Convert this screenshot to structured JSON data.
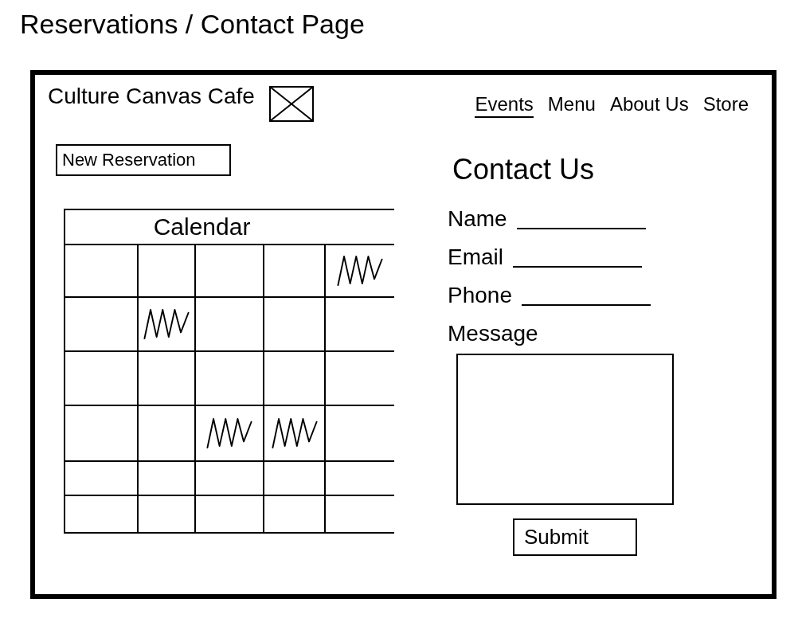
{
  "page_title": "Reservations / Contact Page",
  "header": {
    "brand": "Culture Canvas Cafe",
    "nav": [
      {
        "label": "Events",
        "selected": true
      },
      {
        "label": "Menu",
        "selected": false
      },
      {
        "label": "About Us",
        "selected": false
      },
      {
        "label": "Store",
        "selected": false
      }
    ]
  },
  "reservations": {
    "new_button": "New Reservation",
    "calendar": {
      "title": "Calendar",
      "weeks": [
        {
          "days": [
            {
              "marked": false
            },
            {
              "marked": false
            },
            {
              "marked": false
            },
            {
              "marked": false
            },
            {
              "marked": true
            }
          ]
        },
        {
          "days": [
            {
              "marked": false
            },
            {
              "marked": true
            },
            {
              "marked": false
            },
            {
              "marked": false
            },
            {
              "marked": false
            }
          ]
        },
        {
          "days": [
            {
              "marked": false
            },
            {
              "marked": false
            },
            {
              "marked": false
            },
            {
              "marked": false
            },
            {
              "marked": false
            }
          ]
        },
        {
          "days": [
            {
              "marked": false
            },
            {
              "marked": false
            },
            {
              "marked": true
            },
            {
              "marked": true
            },
            {
              "marked": false
            }
          ]
        },
        {
          "days": [
            {
              "marked": false
            },
            {
              "marked": false
            },
            {
              "marked": false
            },
            {
              "marked": false
            },
            {
              "marked": false
            }
          ]
        },
        {
          "days": [
            {
              "marked": false
            },
            {
              "marked": false
            },
            {
              "marked": false
            },
            {
              "marked": false
            },
            {
              "marked": false
            }
          ]
        }
      ]
    }
  },
  "contact": {
    "title": "Contact Us",
    "fields": [
      {
        "label": "Name",
        "kind": "line"
      },
      {
        "label": "Email",
        "kind": "line"
      },
      {
        "label": "Phone",
        "kind": "line"
      },
      {
        "label": "Message",
        "kind": "box"
      }
    ],
    "submit": "Submit"
  }
}
